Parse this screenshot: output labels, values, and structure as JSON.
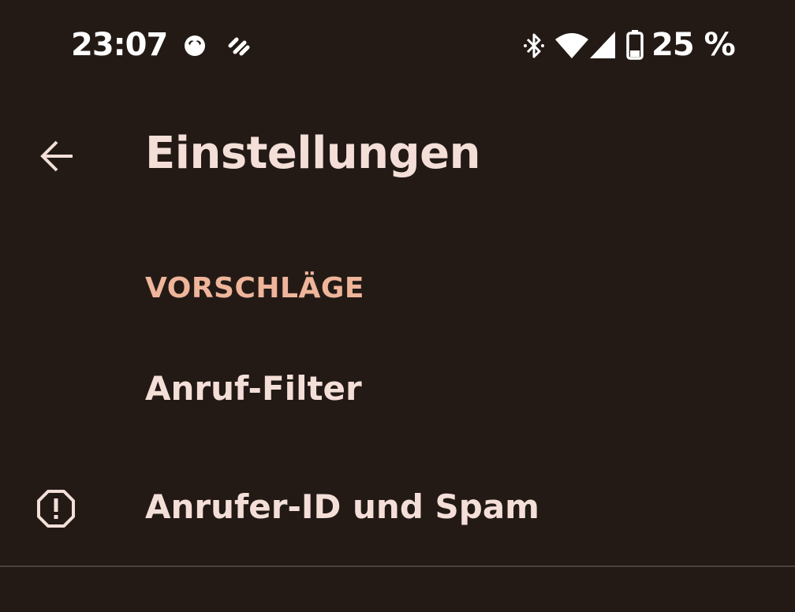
{
  "status_bar": {
    "time": "23:07",
    "battery": "25 %",
    "icons": [
      "face-indicator-icon",
      "data-saver-icon",
      "bluetooth-icon",
      "wifi-icon",
      "signal-icon",
      "battery-icon"
    ]
  },
  "app_bar": {
    "title": "Einstellungen",
    "back_icon": "arrow-left-icon"
  },
  "sections": [
    {
      "header": "VORSCHLÄGE",
      "items": [
        {
          "label": "Anruf-Filter",
          "icon": null
        }
      ]
    },
    {
      "items": [
        {
          "label": "Anrufer-ID und Spam",
          "icon": "alert-octagon-icon"
        }
      ]
    }
  ],
  "colors": {
    "background": "#231a16",
    "text_primary": "#f4dfd8",
    "accent": "#efb59a",
    "divider": "#4a403c"
  }
}
